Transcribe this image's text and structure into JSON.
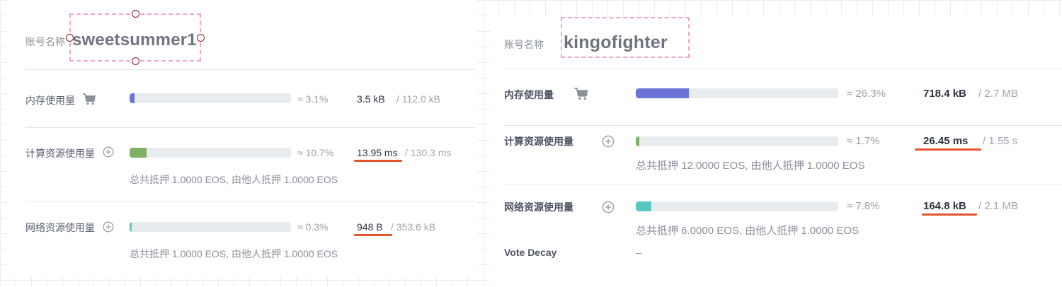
{
  "colors": {
    "memory_fill": "#6b74d6",
    "cpu_fill": "#7fb063",
    "net_fill": "#58c7c0",
    "underline": "#e8512f",
    "dash_box": "#f0a6c8"
  },
  "left": {
    "account_label": "账号名称",
    "account_name": "sweetsummer1",
    "memory": {
      "label": "内存使用量",
      "icon": "cart-icon",
      "percent": 3.1,
      "percent_text": "≈ 3.1%",
      "used": "3.5 kB",
      "total": "/ 112.0 kB"
    },
    "cpu": {
      "label": "计算资源使用量",
      "icon": "plus-circle-icon",
      "percent": 10.7,
      "percent_text": "≈ 10.7%",
      "used": "13.95 ms",
      "total": "/ 130.3 ms",
      "note": "总共抵押 1.0000 EOS, 由他人抵押 1.0000 EOS"
    },
    "net": {
      "label": "网络资源使用量",
      "icon": "plus-circle-icon",
      "percent": 0.3,
      "percent_text": "≈ 0.3%",
      "used": "948 B",
      "total": "/ 353.6 kB",
      "note": "总共抵押 1.0000 EOS, 由他人抵押 1.0000 EOS"
    }
  },
  "right": {
    "account_label": "账号名称",
    "account_name": "kingofighter",
    "memory": {
      "label": "内存使用量",
      "icon": "cart-icon",
      "percent": 26.3,
      "percent_text": "≈ 26.3%",
      "used": "718.4 kB",
      "total": "/ 2.7 MB"
    },
    "cpu": {
      "label": "计算资源使用量",
      "icon": "plus-circle-icon",
      "percent": 1.7,
      "percent_text": "≈ 1.7%",
      "used": "26.45 ms",
      "total": "/ 1.55 s",
      "note": "总共抵押 12.0000 EOS, 由他人抵押 1.0000 EOS"
    },
    "net": {
      "label": "网络资源使用量",
      "icon": "plus-circle-icon",
      "percent": 7.8,
      "percent_text": "≈ 7.8%",
      "used": "164.8 kB",
      "total": "/ 2.1 MB",
      "note": "总共抵押 6.0000 EOS, 由他人抵押 1.0000 EOS"
    },
    "vote_decay": {
      "label": "Vote Decay",
      "value": "–"
    }
  }
}
